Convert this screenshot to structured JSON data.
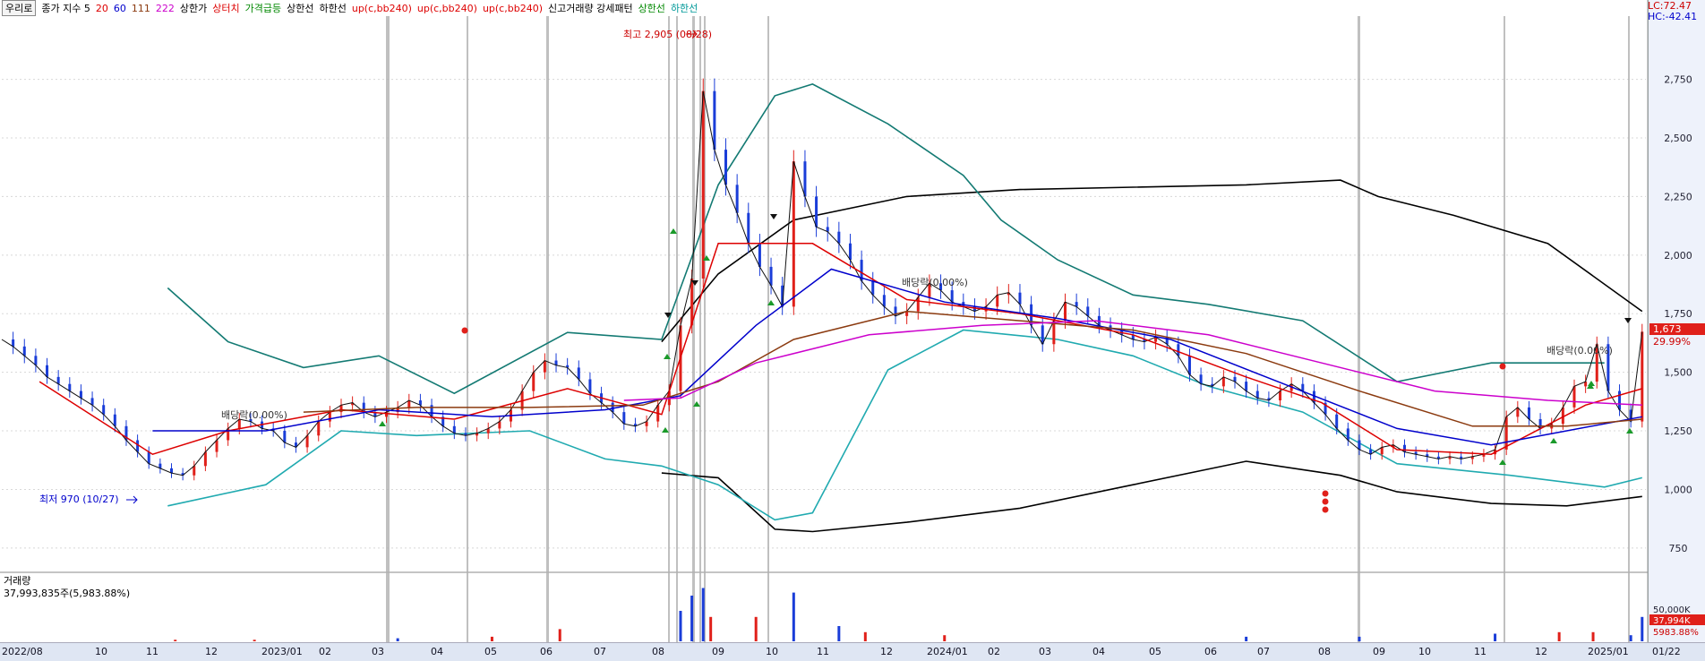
{
  "legend": {
    "stock_name": "우리로",
    "items": [
      {
        "label": "종가 지수 5",
        "color": "#000000"
      },
      {
        "label": "20",
        "color": "#dd0000"
      },
      {
        "label": "60",
        "color": "#0000cc"
      },
      {
        "label": "111",
        "color": "#8b3a0f"
      },
      {
        "label": "222",
        "color": "#cc00cc"
      },
      {
        "label": "상한가",
        "color": "#000000"
      },
      {
        "label": "상터치",
        "color": "#dd0000"
      },
      {
        "label": "가격급등",
        "color": "#008800"
      },
      {
        "label": "상한선",
        "color": "#000000"
      },
      {
        "label": "하한선",
        "color": "#000000"
      },
      {
        "label": "up(c,bb240)",
        "color": "#dd0000"
      },
      {
        "label": "up(c,bb240)",
        "color": "#dd0000"
      },
      {
        "label": "up(c,bb240)",
        "color": "#dd0000"
      },
      {
        "label": "신고거래량 강세패턴",
        "color": "#000000"
      },
      {
        "label": "상한선",
        "color": "#008800"
      },
      {
        "label": "하한선",
        "color": "#009999"
      }
    ]
  },
  "right_info": {
    "lc": "LC:72.47",
    "hc": "HC:-42.41"
  },
  "annotations": {
    "high": "최고 2,905 (08/28)",
    "low": "최저 970 (10/27)",
    "dividend1": "배당락(0.00%)",
    "dividend2": "배당락(0.00%)",
    "dividend3": "배당락(0.00%)"
  },
  "price_tags": {
    "price": "1,673",
    "change": "29.99%",
    "volume": "37,994K",
    "volume_pct": "5983.88%",
    "volume_axis": "50,000K"
  },
  "volume_panel": {
    "title": "거래량",
    "value": "37,993,835주(5,983.88%)"
  },
  "chart_data": {
    "type": "line",
    "title": "우리로",
    "y_ticks": [
      750,
      1000,
      1250,
      1500,
      1750,
      2000,
      2250,
      2500,
      2750
    ],
    "y_tick_labels": [
      "750",
      "1,000",
      "1,250",
      "1,500",
      "1,750",
      "2,000",
      "2,250",
      "2,500",
      "2,750"
    ],
    "ylim": [
      650,
      3020
    ],
    "x_labels": [
      "2022/08",
      "10",
      "11",
      "12",
      "2023/01",
      "02",
      "03",
      "04",
      "05",
      "06",
      "07",
      "08",
      "09",
      "10",
      "11",
      "12",
      "2024/01",
      "02",
      "03",
      "04",
      "05",
      "06",
      "07",
      "08",
      "09",
      "10",
      "11",
      "12",
      "2025/01",
      "01/22"
    ],
    "grid": true,
    "legend_placement": "top-left",
    "close_series": [
      [
        0,
        1640
      ],
      [
        3,
        1610
      ],
      [
        6,
        1570
      ],
      [
        9,
        1530
      ],
      [
        12,
        1480
      ],
      [
        15,
        1450
      ],
      [
        18,
        1420
      ],
      [
        21,
        1390
      ],
      [
        24,
        1360
      ],
      [
        27,
        1320
      ],
      [
        30,
        1270
      ],
      [
        33,
        1210
      ],
      [
        36,
        1160
      ],
      [
        39,
        1110
      ],
      [
        42,
        1090
      ],
      [
        45,
        1070
      ],
      [
        48,
        1060
      ],
      [
        51,
        1100
      ],
      [
        54,
        1160
      ],
      [
        57,
        1210
      ],
      [
        60,
        1260
      ],
      [
        63,
        1300
      ],
      [
        66,
        1290
      ],
      [
        69,
        1260
      ],
      [
        72,
        1250
      ],
      [
        75,
        1200
      ],
      [
        78,
        1180
      ],
      [
        81,
        1230
      ],
      [
        84,
        1290
      ],
      [
        87,
        1330
      ],
      [
        90,
        1360
      ],
      [
        93,
        1370
      ],
      [
        96,
        1330
      ],
      [
        99,
        1310
      ],
      [
        102,
        1330
      ],
      [
        105,
        1350
      ],
      [
        108,
        1380
      ],
      [
        111,
        1360
      ],
      [
        114,
        1310
      ],
      [
        117,
        1270
      ],
      [
        120,
        1240
      ],
      [
        123,
        1230
      ],
      [
        126,
        1240
      ],
      [
        129,
        1260
      ],
      [
        132,
        1290
      ],
      [
        135,
        1340
      ],
      [
        138,
        1420
      ],
      [
        141,
        1500
      ],
      [
        144,
        1550
      ],
      [
        147,
        1530
      ],
      [
        150,
        1520
      ],
      [
        153,
        1470
      ],
      [
        156,
        1410
      ],
      [
        159,
        1370
      ],
      [
        162,
        1330
      ],
      [
        165,
        1280
      ],
      [
        168,
        1270
      ],
      [
        171,
        1290
      ],
      [
        174,
        1360
      ],
      [
        177,
        1420
      ],
      [
        180,
        1700
      ],
      [
        183,
        1900
      ],
      [
        186,
        2700
      ],
      [
        189,
        2450
      ],
      [
        192,
        2300
      ],
      [
        195,
        2180
      ],
      [
        198,
        2050
      ],
      [
        201,
        1950
      ],
      [
        204,
        1870
      ],
      [
        207,
        1780
      ],
      [
        210,
        2400
      ],
      [
        213,
        2250
      ],
      [
        216,
        2120
      ],
      [
        219,
        2100
      ],
      [
        222,
        2050
      ],
      [
        225,
        1980
      ],
      [
        228,
        1890
      ],
      [
        231,
        1830
      ],
      [
        234,
        1780
      ],
      [
        237,
        1740
      ],
      [
        240,
        1760
      ],
      [
        243,
        1820
      ],
      [
        246,
        1880
      ],
      [
        249,
        1850
      ],
      [
        252,
        1800
      ],
      [
        255,
        1780
      ],
      [
        258,
        1760
      ],
      [
        261,
        1780
      ],
      [
        264,
        1830
      ],
      [
        267,
        1840
      ],
      [
        270,
        1790
      ],
      [
        273,
        1700
      ],
      [
        276,
        1620
      ],
      [
        279,
        1720
      ],
      [
        282,
        1800
      ],
      [
        285,
        1780
      ],
      [
        288,
        1740
      ],
      [
        291,
        1700
      ],
      [
        294,
        1680
      ],
      [
        297,
        1660
      ],
      [
        300,
        1640
      ],
      [
        303,
        1630
      ],
      [
        306,
        1650
      ],
      [
        309,
        1620
      ],
      [
        312,
        1570
      ],
      [
        315,
        1490
      ],
      [
        318,
        1450
      ],
      [
        321,
        1440
      ],
      [
        324,
        1480
      ],
      [
        327,
        1460
      ],
      [
        330,
        1420
      ],
      [
        333,
        1390
      ],
      [
        336,
        1380
      ],
      [
        339,
        1420
      ],
      [
        342,
        1450
      ],
      [
        345,
        1420
      ],
      [
        348,
        1370
      ],
      [
        351,
        1320
      ],
      [
        354,
        1260
      ],
      [
        357,
        1210
      ],
      [
        360,
        1170
      ],
      [
        363,
        1150
      ],
      [
        366,
        1180
      ],
      [
        369,
        1190
      ],
      [
        372,
        1160
      ],
      [
        375,
        1150
      ],
      [
        378,
        1140
      ],
      [
        381,
        1130
      ],
      [
        384,
        1140
      ],
      [
        387,
        1130
      ],
      [
        390,
        1140
      ],
      [
        393,
        1150
      ],
      [
        396,
        1170
      ],
      [
        399,
        1310
      ],
      [
        402,
        1350
      ],
      [
        405,
        1300
      ],
      [
        408,
        1260
      ],
      [
        411,
        1280
      ],
      [
        414,
        1350
      ],
      [
        417,
        1440
      ],
      [
        420,
        1460
      ],
      [
        423,
        1620
      ],
      [
        426,
        1420
      ],
      [
        429,
        1340
      ],
      [
        432,
        1290
      ],
      [
        435,
        1673
      ]
    ],
    "series": [
      {
        "name": "20",
        "color": "#dd0000",
        "values": [
          [
            10,
            1460
          ],
          [
            40,
            1150
          ],
          [
            60,
            1250
          ],
          [
            90,
            1340
          ],
          [
            120,
            1300
          ],
          [
            150,
            1430
          ],
          [
            175,
            1320
          ],
          [
            190,
            2050
          ],
          [
            215,
            2050
          ],
          [
            240,
            1810
          ],
          [
            270,
            1750
          ],
          [
            300,
            1660
          ],
          [
            330,
            1480
          ],
          [
            350,
            1370
          ],
          [
            370,
            1170
          ],
          [
            395,
            1150
          ],
          [
            420,
            1360
          ],
          [
            435,
            1430
          ]
        ]
      },
      {
        "name": "60",
        "color": "#0000cc",
        "values": [
          [
            40,
            1250
          ],
          [
            70,
            1250
          ],
          [
            100,
            1340
          ],
          [
            130,
            1310
          ],
          [
            160,
            1340
          ],
          [
            180,
            1400
          ],
          [
            200,
            1700
          ],
          [
            220,
            1940
          ],
          [
            250,
            1800
          ],
          [
            280,
            1730
          ],
          [
            310,
            1640
          ],
          [
            340,
            1450
          ],
          [
            370,
            1260
          ],
          [
            395,
            1190
          ],
          [
            415,
            1250
          ],
          [
            435,
            1310
          ]
        ]
      },
      {
        "name": "111",
        "color": "#8b3a0f",
        "values": [
          [
            80,
            1330
          ],
          [
            110,
            1350
          ],
          [
            140,
            1350
          ],
          [
            170,
            1360
          ],
          [
            190,
            1460
          ],
          [
            210,
            1640
          ],
          [
            240,
            1760
          ],
          [
            270,
            1720
          ],
          [
            300,
            1680
          ],
          [
            330,
            1580
          ],
          [
            360,
            1420
          ],
          [
            390,
            1270
          ],
          [
            415,
            1270
          ],
          [
            435,
            1300
          ]
        ]
      },
      {
        "name": "222",
        "color": "#cc00cc",
        "values": [
          [
            165,
            1380
          ],
          [
            180,
            1390
          ],
          [
            200,
            1540
          ],
          [
            230,
            1660
          ],
          [
            260,
            1700
          ],
          [
            290,
            1720
          ],
          [
            320,
            1660
          ],
          [
            350,
            1540
          ],
          [
            380,
            1420
          ],
          [
            410,
            1380
          ],
          [
            435,
            1360
          ]
        ]
      }
    ],
    "bands": {
      "upper_long": [
        [
          175,
          1630
        ],
        [
          190,
          1920
        ],
        [
          210,
          2150
        ],
        [
          240,
          2250
        ],
        [
          270,
          2280
        ],
        [
          300,
          2290
        ],
        [
          330,
          2300
        ],
        [
          355,
          2320
        ],
        [
          365,
          2250
        ],
        [
          385,
          2170
        ],
        [
          410,
          2050
        ],
        [
          435,
          1760
        ]
      ],
      "lower_long": [
        [
          175,
          1070
        ],
        [
          190,
          1050
        ],
        [
          205,
          830
        ],
        [
          215,
          820
        ],
        [
          240,
          860
        ],
        [
          270,
          920
        ],
        [
          300,
          1020
        ],
        [
          330,
          1120
        ],
        [
          355,
          1060
        ],
        [
          370,
          990
        ],
        [
          395,
          940
        ],
        [
          415,
          930
        ],
        [
          435,
          970
        ]
      ],
      "upper_short": [
        [
          44,
          1860
        ],
        [
          60,
          1630
        ],
        [
          80,
          1520
        ],
        [
          100,
          1570
        ],
        [
          120,
          1410
        ],
        [
          150,
          1670
        ],
        [
          175,
          1640
        ],
        [
          190,
          2300
        ],
        [
          205,
          2680
        ],
        [
          215,
          2730
        ],
        [
          235,
          2560
        ],
        [
          255,
          2340
        ],
        [
          265,
          2150
        ],
        [
          280,
          1980
        ],
        [
          300,
          1830
        ],
        [
          320,
          1790
        ],
        [
          345,
          1720
        ],
        [
          370,
          1460
        ],
        [
          395,
          1540
        ],
        [
          425,
          1540
        ]
      ],
      "lower_short": [
        [
          44,
          930
        ],
        [
          70,
          1020
        ],
        [
          90,
          1250
        ],
        [
          110,
          1230
        ],
        [
          140,
          1250
        ],
        [
          160,
          1130
        ],
        [
          175,
          1100
        ],
        [
          190,
          1020
        ],
        [
          205,
          870
        ],
        [
          215,
          900
        ],
        [
          235,
          1510
        ],
        [
          255,
          1680
        ],
        [
          280,
          1640
        ],
        [
          300,
          1570
        ],
        [
          320,
          1440
        ],
        [
          345,
          1330
        ],
        [
          370,
          1110
        ],
        [
          400,
          1060
        ],
        [
          425,
          1010
        ],
        [
          435,
          1050
        ]
      ]
    },
    "volume": [
      [
        46,
        1
      ],
      [
        67,
        1
      ],
      [
        105,
        2
      ],
      [
        130,
        3
      ],
      [
        148,
        8
      ],
      [
        180,
        20
      ],
      [
        183,
        30
      ],
      [
        186,
        35
      ],
      [
        188,
        16
      ],
      [
        200,
        16
      ],
      [
        210,
        32
      ],
      [
        222,
        10
      ],
      [
        229,
        6
      ],
      [
        250,
        4
      ],
      [
        330,
        3
      ],
      [
        360,
        3
      ],
      [
        396,
        5
      ],
      [
        413,
        6
      ],
      [
        422,
        6
      ],
      [
        432,
        4
      ],
      [
        435,
        16
      ]
    ]
  }
}
